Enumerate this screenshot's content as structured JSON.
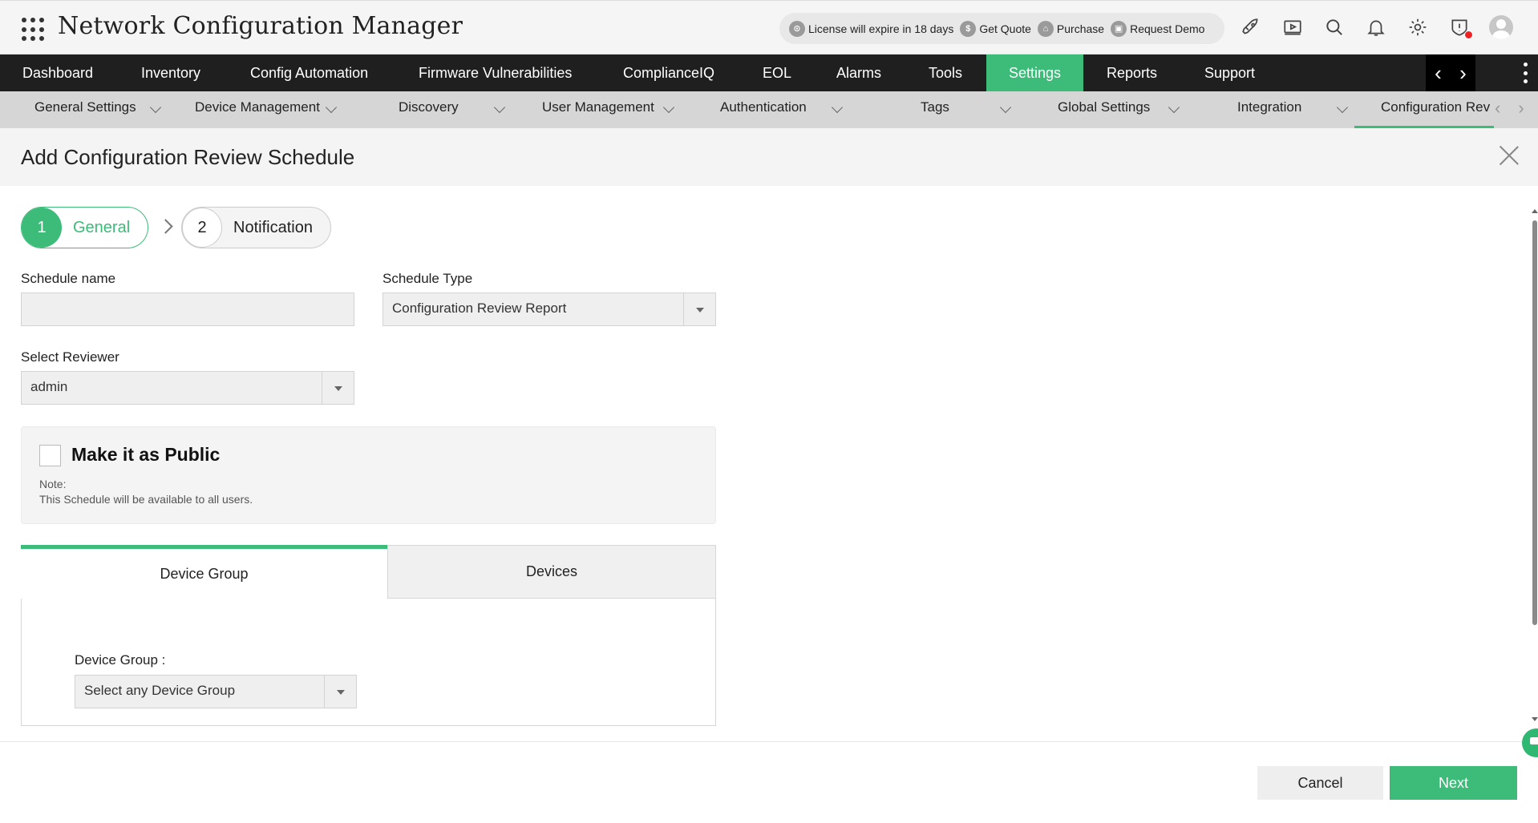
{
  "header": {
    "app_title": "Network Configuration Manager",
    "promo": {
      "license": "License will expire in 18 days",
      "quote": "Get Quote",
      "purchase": "Purchase",
      "demo": "Request Demo"
    },
    "icons": [
      "rocket-icon",
      "video-icon",
      "search-icon",
      "bell-icon",
      "gear-icon",
      "alert-shield-icon",
      "avatar"
    ]
  },
  "main_nav": {
    "items": [
      "Dashboard",
      "Inventory",
      "Config Automation",
      "Firmware Vulnerabilities",
      "ComplianceIQ",
      "EOL",
      "Alarms",
      "Tools",
      "Settings",
      "Reports",
      "Support"
    ],
    "active": "Settings"
  },
  "sub_nav": {
    "items": [
      "General Settings",
      "Device Management",
      "Discovery",
      "User Management",
      "Authentication",
      "Tags",
      "Global Settings",
      "Integration",
      "Configuration Rev"
    ],
    "active": "Configuration Rev"
  },
  "dialog": {
    "title": "Add Configuration Review Schedule",
    "steps": [
      {
        "num": "1",
        "label": "General"
      },
      {
        "num": "2",
        "label": "Notification"
      }
    ],
    "schedule_name_label": "Schedule name",
    "schedule_name_value": "",
    "schedule_type_label": "Schedule Type",
    "schedule_type_value": "Configuration Review Report",
    "reviewer_label": "Select Reviewer",
    "reviewer_value": "admin",
    "public_label": "Make it as Public",
    "note_title": "Note:",
    "note_text": "This Schedule will be available to all users.",
    "tabs": [
      "Device Group",
      "Devices"
    ],
    "device_group_label": "Device Group :",
    "device_group_value": "Select any Device Group"
  },
  "footer": {
    "cancel": "Cancel",
    "next": "Next"
  },
  "colors": {
    "accent": "#3dbb78",
    "nav_bg": "#1f1f1f",
    "subnav_bg": "#d6d6d6"
  }
}
